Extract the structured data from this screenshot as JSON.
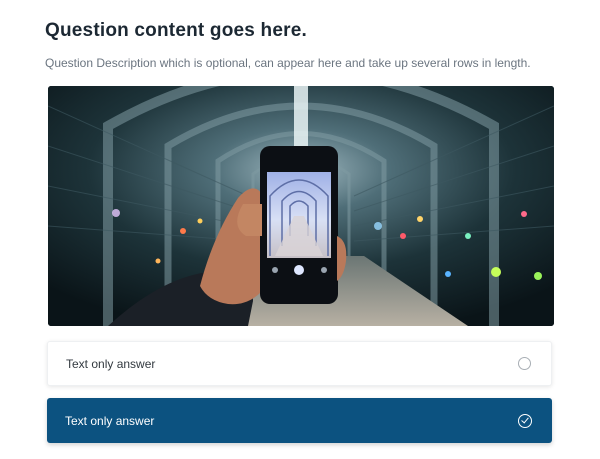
{
  "question": {
    "title": "Question content goes here.",
    "description": "Question Description which is optional, can appear here and take up several rows in length."
  },
  "image": {
    "icon": "photo-of-phone-in-walkway"
  },
  "answers": [
    {
      "label": "Text only answer",
      "selected": false,
      "icon": "radio-empty-icon"
    },
    {
      "label": "Text only answer",
      "selected": true,
      "icon": "check-circle-icon"
    }
  ],
  "colors": {
    "selected_bg": "#0c5280",
    "title": "#1c2833",
    "description": "#6b7580"
  }
}
